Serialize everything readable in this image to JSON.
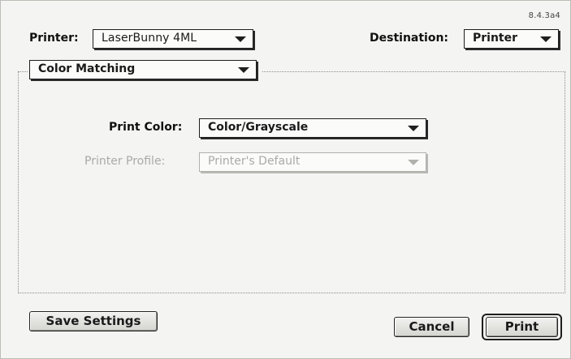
{
  "version": "8.4.3a4",
  "printer": {
    "label": "Printer:",
    "value": "LaserBunny 4ML"
  },
  "destination": {
    "label": "Destination:",
    "value": "Printer"
  },
  "panel": {
    "value": "Color Matching"
  },
  "print_color": {
    "label": "Print Color:",
    "value": "Color/Grayscale"
  },
  "printer_profile": {
    "label": "Printer Profile:",
    "value": "Printer's Default"
  },
  "buttons": {
    "save_settings": "Save Settings",
    "cancel": "Cancel",
    "print": "Print"
  }
}
